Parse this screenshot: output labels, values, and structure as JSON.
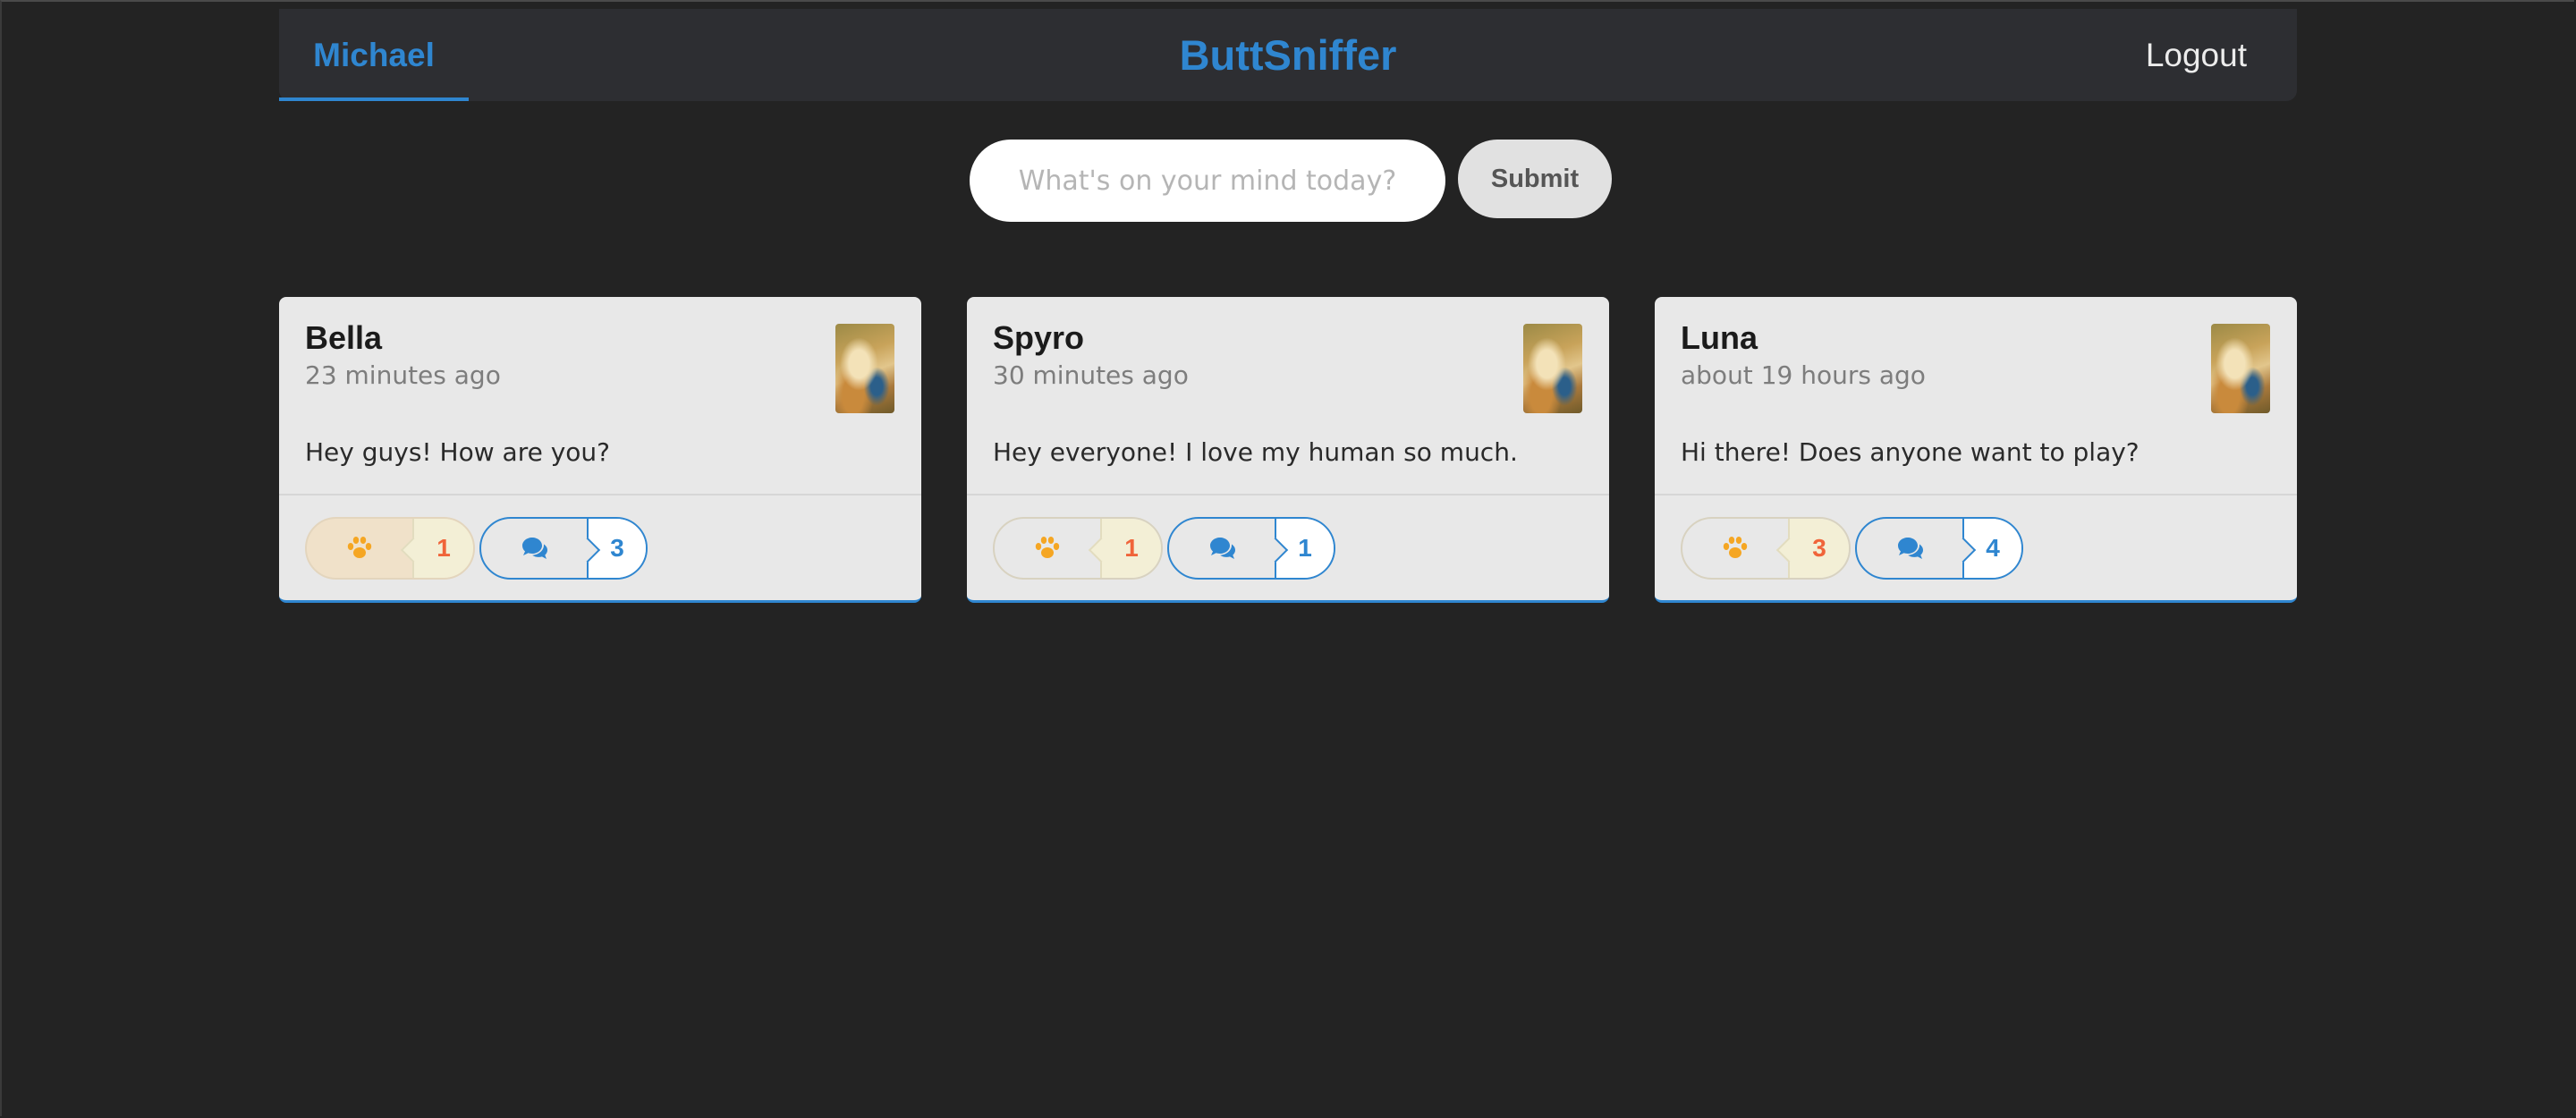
{
  "nav": {
    "user": "Michael",
    "brand": "ButtSniffer",
    "logout": "Logout"
  },
  "form": {
    "placeholder": "What's on your mind today?",
    "submit": "Submit"
  },
  "colors": {
    "accent": "#2f86d0",
    "background": "#232323",
    "like_icon": "#f5a623",
    "like_count": "#f0643a"
  },
  "icons": {
    "like": "paw-icon",
    "comment": "comments-icon"
  },
  "posts": [
    {
      "author": "Bella",
      "time": "23 minutes ago",
      "text": "Hey guys! How are you?",
      "likes": "1",
      "comments": "3",
      "liked": true
    },
    {
      "author": "Spyro",
      "time": "30 minutes ago",
      "text": "Hey everyone! I love my human so much.",
      "likes": "1",
      "comments": "1",
      "liked": false
    },
    {
      "author": "Luna",
      "time": "about 19 hours ago",
      "text": "Hi there! Does anyone want to play?",
      "likes": "3",
      "comments": "4",
      "liked": false
    }
  ]
}
